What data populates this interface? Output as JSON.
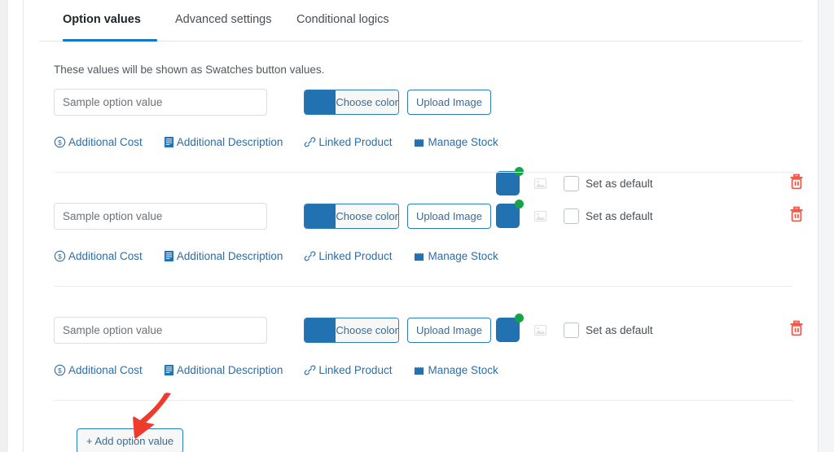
{
  "tabs": [
    {
      "label": "Option values",
      "active": true
    },
    {
      "label": "Advanced settings",
      "active": false
    },
    {
      "label": "Conditional logics",
      "active": false
    }
  ],
  "helper_text": "These values will be shown as Swatches button values.",
  "rows": [
    {
      "value": "Sample option value",
      "placeholder": "Sample option value",
      "choose_color_label": "Choose color",
      "upload_image_label": "Upload Image",
      "swatch_color": "#2271b1",
      "badge_color": "#16a34a",
      "set_as_default_label": "Set as default",
      "checked": false,
      "links": [
        {
          "label": "Additional Cost",
          "icon": "dollar-circle-icon"
        },
        {
          "label": "Additional Description",
          "icon": "document-lines-icon"
        },
        {
          "label": "Linked Product",
          "icon": "chain-link-icon"
        },
        {
          "label": "Manage Stock",
          "icon": "shop-awning-icon"
        }
      ]
    },
    {
      "value": "Sample option value",
      "placeholder": "Sample option value",
      "choose_color_label": "Choose color",
      "upload_image_label": "Upload Image",
      "swatch_color": "#2271b1",
      "badge_color": "#16a34a",
      "set_as_default_label": "Set as default",
      "checked": false,
      "links": [
        {
          "label": "Additional Cost",
          "icon": "dollar-circle-icon"
        },
        {
          "label": "Additional Description",
          "icon": "document-lines-icon"
        },
        {
          "label": "Linked Product",
          "icon": "chain-link-icon"
        },
        {
          "label": "Manage Stock",
          "icon": "shop-awning-icon"
        }
      ]
    },
    {
      "value": "Sample option value",
      "placeholder": "Sample option value",
      "choose_color_label": "Choose color",
      "upload_image_label": "Upload Image",
      "swatch_color": "#2271b1",
      "badge_color": "#16a34a",
      "set_as_default_label": "Set as default",
      "checked": false,
      "links": [
        {
          "label": "Additional Cost",
          "icon": "dollar-circle-icon"
        },
        {
          "label": "Additional Description",
          "icon": "document-lines-icon"
        },
        {
          "label": "Linked Product",
          "icon": "chain-link-icon"
        },
        {
          "label": "Manage Stock",
          "icon": "shop-awning-icon"
        }
      ]
    }
  ],
  "add_button_label": "+ Add option value",
  "colors": {
    "accent_blue": "#2271b1",
    "tab_underline": "#1279c6",
    "link_blue": "#2e6da4",
    "delete_red": "#f15a4a",
    "badge_green": "#16a34a",
    "annotation_red": "#ef3b2d"
  },
  "annotation": {
    "type": "arrow",
    "points_to": "add-option-value-button",
    "color": "#ef3b2d"
  }
}
